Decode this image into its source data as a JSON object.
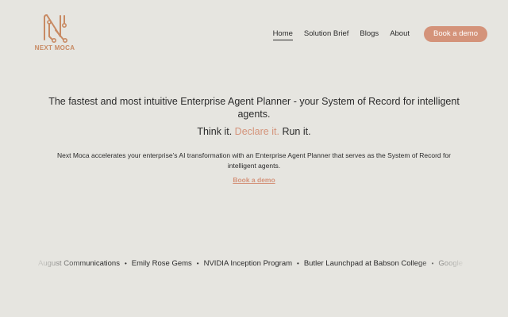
{
  "brand": {
    "name": "NEXT MOCA",
    "logo_icon": "circuit-n-icon",
    "accent_color": "#d4937a",
    "logo_color": "#c88a63"
  },
  "nav": {
    "items": [
      {
        "label": "Home",
        "active": true
      },
      {
        "label": "Solution Brief",
        "active": false
      },
      {
        "label": "Blogs",
        "active": false
      },
      {
        "label": "About",
        "active": false
      }
    ],
    "cta": "Book a demo"
  },
  "hero": {
    "headline": "The fastest and most intuitive Enterprise Agent Planner - your System of Record for intelligent agents.",
    "tagline": {
      "part1": "Think it.",
      "part2": "Declare it.",
      "part3": "Run it."
    },
    "description": "Next Moca accelerates your enterprise’s AI transformation with an Enterprise Agent Planner that serves as the System of Record for intelligent agents.",
    "cta": "Book a demo"
  },
  "partners": {
    "separator": "•",
    "items": [
      "August Communications",
      "Emily Rose Gems",
      "NVIDIA Inception Program",
      "Butler Launchpad at Babson College",
      "Google"
    ]
  }
}
